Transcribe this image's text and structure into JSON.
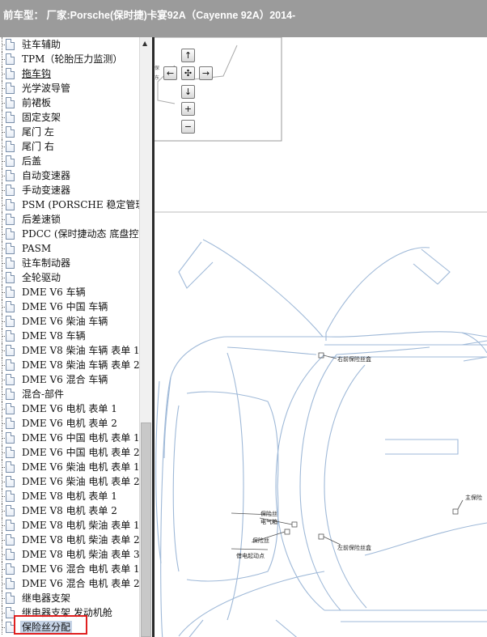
{
  "header": {
    "title": "前车型： 厂家:Porsche(保时捷)卡宴92A（Cayenne 92A）2014-"
  },
  "tree": {
    "items": [
      "驻车辅助",
      "TPM（轮胎压力监测）",
      "拖车钩",
      "光学波导管",
      "前裙板",
      "固定支架",
      "尾门 左",
      "尾门 右",
      "后盖",
      "自动变速器",
      "手动变速器",
      "PSM (PORSCHE 稳定管理",
      "后差速锁",
      "PDCC (保时捷动态 底盘控",
      "PASM",
      "驻车制动器",
      "全轮驱动",
      "DME V6 车辆",
      "DME V6 中国 车辆",
      "DME V6 柴油 车辆",
      "DME V8 车辆",
      "DME V8 柴油 车辆 表单 1",
      "DME V8 柴油 车辆 表单 2",
      "DME V6 混合 车辆",
      "混合-部件",
      "DME V6 电机 表单 1",
      "DME V6 电机 表单 2",
      "DME V6 中国 电机 表单 1",
      "DME V6 中国 电机 表单 2",
      "DME V6 柴油 电机 表单 1",
      "DME V6 柴油 电机 表单 2",
      "DME V8 电机 表单 1",
      "DME V8 电机 表单 2",
      "DME V8 电机 柴油 表单 1",
      "DME V8 电机 柴油 表单 2",
      "DME V8 电机 柴油 表单 3",
      "DME V6 混合 电机 表单 1",
      "DME V6 混合 电机 表单 2",
      "继电器支架",
      "继电器支架 发动机舱",
      "保险丝分配"
    ],
    "selected_index": 40,
    "underlined_index": 2
  },
  "diagram": {
    "labels": {
      "right_front_fuse_box": "右前保险丝盒",
      "left_front_fuse_box": "左前保险丝盒",
      "fuse_electric_box_1": "保险丝",
      "fuse_electric_box_2": "电气箱",
      "fuse": "保险丝",
      "jump_start_point": "借电起动点",
      "main_fuse": "主保险",
      "inset_partial_1": "保",
      "inset_partial_2": "东"
    }
  },
  "nav": {
    "up": "↑",
    "down": "↓",
    "left": "←",
    "right": "→",
    "center": "✣",
    "zoom_in": "+",
    "zoom_out": "−"
  }
}
